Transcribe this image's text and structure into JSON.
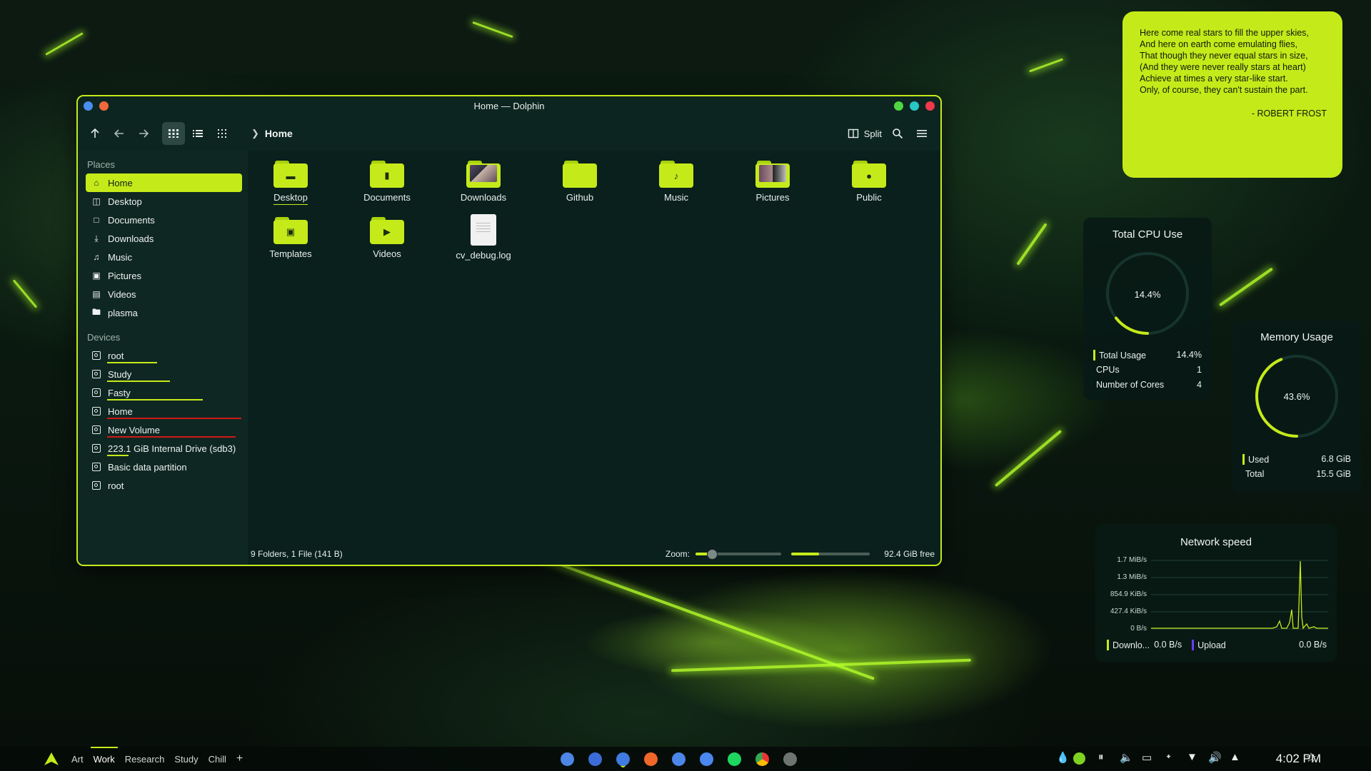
{
  "window": {
    "title": "Home — Dolphin",
    "breadcrumb": "Home",
    "split_label": "Split"
  },
  "sidebar": {
    "places_header": "Places",
    "places": [
      {
        "label": "Home",
        "icon": "home-icon"
      },
      {
        "label": "Desktop",
        "icon": "desktop-icon"
      },
      {
        "label": "Documents",
        "icon": "document-icon"
      },
      {
        "label": "Downloads",
        "icon": "download-icon"
      },
      {
        "label": "Music",
        "icon": "music-icon"
      },
      {
        "label": "Pictures",
        "icon": "picture-icon"
      },
      {
        "label": "Videos",
        "icon": "video-icon"
      },
      {
        "label": "plasma",
        "icon": "folder-icon"
      }
    ],
    "devices_header": "Devices",
    "devices": [
      {
        "label": "root",
        "usage_color": "#c5ea1a"
      },
      {
        "label": "Study",
        "usage_color": "#c5ea1a"
      },
      {
        "label": "Fasty",
        "usage_color": "#c5ea1a"
      },
      {
        "label": "Home",
        "usage_color": "#d01818"
      },
      {
        "label": "New Volume",
        "usage_color": "#d01818"
      },
      {
        "label": "223.1 GiB Internal Drive (sdb3)",
        "usage_color": "#c5ea1a"
      },
      {
        "label": "Basic data partition",
        "usage_color": ""
      },
      {
        "label": "root",
        "usage_color": ""
      }
    ]
  },
  "files": [
    {
      "name": "Desktop",
      "kind": "folder",
      "icon": "desktop-folder-icon"
    },
    {
      "name": "Documents",
      "kind": "folder",
      "icon": "documents-folder-icon"
    },
    {
      "name": "Downloads",
      "kind": "folder-preview",
      "icon": "downloads-folder-icon"
    },
    {
      "name": "Github",
      "kind": "folder",
      "icon": "folder-icon"
    },
    {
      "name": "Music",
      "kind": "folder",
      "icon": "music-folder-icon"
    },
    {
      "name": "Pictures",
      "kind": "folder-preview",
      "icon": "pictures-folder-icon"
    },
    {
      "name": "Public",
      "kind": "folder",
      "icon": "public-folder-icon"
    },
    {
      "name": "Templates",
      "kind": "folder",
      "icon": "templates-folder-icon"
    },
    {
      "name": "Videos",
      "kind": "folder",
      "icon": "videos-folder-icon"
    },
    {
      "name": "cv_debug.log",
      "kind": "file",
      "icon": "text-file-icon"
    }
  ],
  "status": {
    "summary": "9 Folders, 1 File (141 B)",
    "zoom_label": "Zoom:",
    "zoom_level": 0.18,
    "disk_used_fraction": 0.35,
    "free_space": "92.4 GiB free"
  },
  "quote": {
    "lines": [
      "Here come real stars to fill the upper skies,",
      "And here on earth come emulating flies,",
      "That though they never equal stars in size,",
      "(And they were never really stars at heart)",
      "Achieve at times a very star-like start.",
      "Only, of course, they can't sustain the part."
    ],
    "author": "- ROBERT FROST"
  },
  "cpu": {
    "title": "Total CPU Use",
    "percent_label": "14.4%",
    "percent": 14.4,
    "rows": [
      {
        "key": "Total Usage",
        "value": "14.4%"
      },
      {
        "key": "CPUs",
        "value": "1"
      },
      {
        "key": "Number of Cores",
        "value": "4"
      }
    ]
  },
  "memory": {
    "title": "Memory Usage",
    "percent_label": "43.6%",
    "percent": 43.6,
    "rows": [
      {
        "key": "Used",
        "value": "6.8 GiB"
      },
      {
        "key": "Total",
        "value": "15.5 GiB"
      }
    ]
  },
  "network": {
    "title": "Network speed",
    "ticks": [
      "1.7 MiB/s",
      "1.3 MiB/s",
      "854.9 KiB/s",
      "427.4 KiB/s",
      "0 B/s"
    ],
    "download_label": "Downlo...",
    "download_value": "0.0 B/s",
    "upload_label": "Upload",
    "upload_value": "0.0 B/s",
    "download_color": "#c5ea1a",
    "upload_color": "#6a3cff"
  },
  "taskbar": {
    "desktops": [
      "Art",
      "Work",
      "Research",
      "Study",
      "Chill"
    ],
    "current_desktop": "Work",
    "add_label": "+",
    "clock": "4:02 PM"
  },
  "colors": {
    "accent": "#c5ea1a",
    "window_bg": "#0d2520"
  }
}
